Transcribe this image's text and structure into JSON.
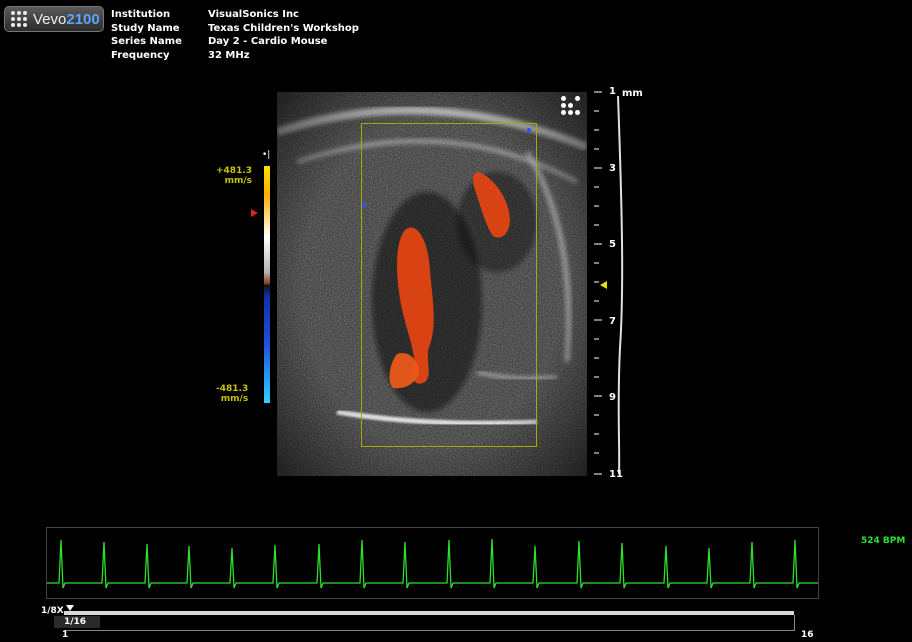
{
  "app": {
    "name": "Vevo",
    "version": "2100"
  },
  "study_info": [
    {
      "label": "Institution",
      "value": "VisualSonics Inc"
    },
    {
      "label": "Study Name",
      "value": "Texas Children's Workshop"
    },
    {
      "label": "Series Name",
      "value": "Day 2 - Cardio Mouse"
    },
    {
      "label": "Frequency",
      "value": "32 MHz"
    }
  ],
  "color_scale": {
    "max_value": "+481.3",
    "min_value": "-481.3",
    "unit": "mm/s",
    "icon": "•|"
  },
  "depth_scale": {
    "unit": "mm",
    "labels": [
      "1",
      "3",
      "5",
      "7",
      "9",
      "11"
    ]
  },
  "ecg": {
    "heart_rate": "524 BPM",
    "color": "#2ee02e"
  },
  "playback": {
    "speed": "1/8X",
    "current_frame": "1/16",
    "start_frame": "1",
    "end_frame": "16"
  },
  "colors": {
    "accent": "#c8c200",
    "doppler_red": "#e03c10",
    "roi_border": "#a8a800"
  }
}
